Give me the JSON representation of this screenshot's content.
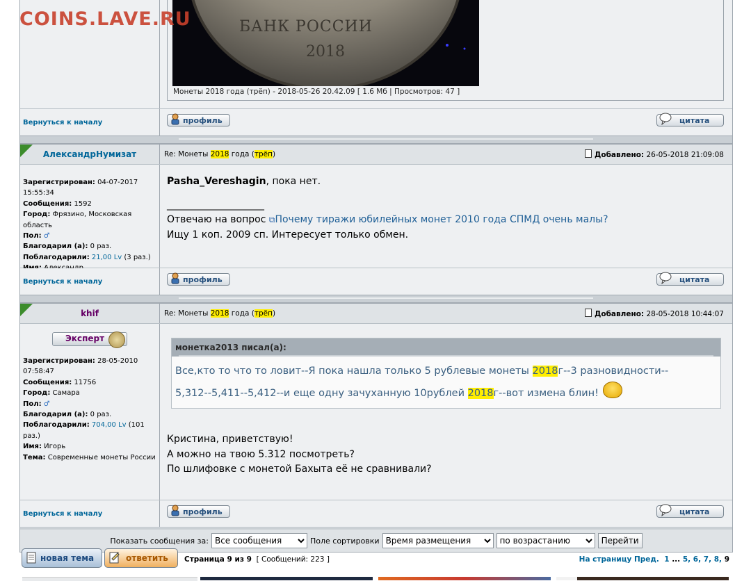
{
  "site": {
    "logo": "COINS.LAVE.RU"
  },
  "coin_image": {
    "text1": "БАНК РОССИИ",
    "text2": "2018"
  },
  "attachment": {
    "name": "Монеты 2018 года (трёп) - 2018-05-26 20.42.09",
    "meta": "[ 1.6 Мб | Просмотров: 47 ]"
  },
  "common": {
    "back_to_top": "Вернуться к началу",
    "profile_button": "профиль",
    "quote_button": "цитата",
    "subject_prefix": "Re: Монеты ",
    "subject_year": "2018",
    "subject_mid": " года (",
    "subject_word": "трёп",
    "subject_end": ")",
    "added_label": "Добавлено:"
  },
  "posts": [
    {
      "author": "АлександрНумизат",
      "author_color": "#006699",
      "date": "26-05-2018 21:09:08",
      "info": {
        "registered_label": "Зарегистрирован:",
        "registered": "04-07-2017 15:55:34",
        "messages_label": "Сообщения:",
        "messages": "1592",
        "city_label": "Город:",
        "city": "Фрязино, Московская область",
        "gender_label": "Пол:",
        "thanked_label": "Благодарил (а):",
        "thanked": "0 раз.",
        "thanks_label": "Поблагодарили:",
        "thanks_amount": "21,00 Lv",
        "thanks_count": "(3 раз.)",
        "name_label": "Имя:",
        "name": "Александр"
      },
      "body": {
        "addressee": "Pasha_Vereshagin",
        "text": ", пока нет.",
        "signature_line": "____________________",
        "sig_prefix": "Отвечаю на вопрос ",
        "sig_link": "Почему тиражи юбилейных монет 2010 года СПМД очень малы?",
        "sig_line2": "Ищу 1 коп. 2009 сп. Интересует только обмен."
      }
    },
    {
      "author": "khif",
      "author_color": "#660066",
      "rank_badge": "Эксперт",
      "date": "28-05-2018 10:44:07",
      "info": {
        "registered_label": "Зарегистрирован:",
        "registered": "28-05-2010 07:58:47",
        "messages_label": "Сообщения:",
        "messages": "11756",
        "city_label": "Город:",
        "city": "Самара",
        "gender_label": "Пол:",
        "thanked_label": "Благодарил (а):",
        "thanked": "0 раз.",
        "thanks_label": "Поблагодарили:",
        "thanks_amount": "704,00 Lv",
        "thanks_count": "(101 раз.)",
        "name_label": "Имя:",
        "name": "Игорь",
        "topic_label": "Тема:",
        "topic": "Современные монеты России"
      },
      "quote": {
        "header": "монетка2013 писал(а):",
        "l1_a": "Все,кто то что то ловит--Я пока нашла только 5 рублевые монеты ",
        "l1_hl": "2018",
        "l1_b": "г--3 разновидности--",
        "l2_a": "5,312--5,411--5,412--и еще одну зачуханную 10рублей ",
        "l2_hl": "2018",
        "l2_b": "г--вот измена блин!"
      },
      "body": {
        "line1": "Кристина, приветствую!",
        "line2": "А можно на твою 5.312 посмотреть?",
        "line3": "По шлифовке с монетой Бахыта её не сравнивали?"
      }
    }
  ],
  "sort_bar": {
    "show_label": "Показать сообщения за:",
    "show_value": "Все сообщения",
    "sort_label": "Поле сортировки",
    "sort_value": "Время размещения",
    "order_value": "по возрастанию",
    "go_button": "Перейти"
  },
  "bottom": {
    "new_topic": "новая тема",
    "reply": "ответить",
    "page_info": "Страница 9 из 9",
    "count_info": "[ Сообщений: 223 ]",
    "goto_label": "На страницу",
    "prev": "Пред.",
    "p1": "1",
    "ellipsis": "...",
    "p5": "5",
    "p6": "6",
    "p7": "7",
    "p8": "8",
    "p9": "9"
  },
  "colors": {
    "highlight": "#ffee00",
    "link": "#006699",
    "row_bg": "#eef0f2",
    "header_bg": "#dfe3e6",
    "logo": "#c8402c"
  }
}
